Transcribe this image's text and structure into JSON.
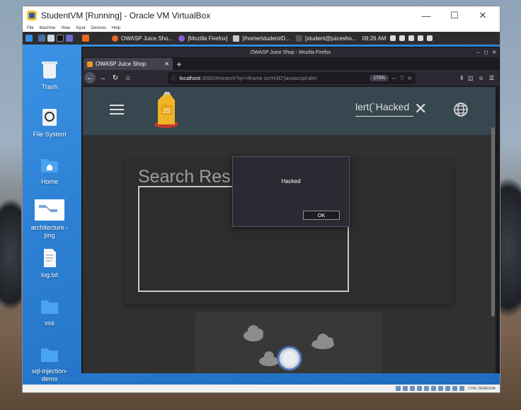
{
  "host": {
    "window_title": "StudentVM [Running] - Oracle VM VirtualBox",
    "menu": [
      "File",
      "Machine",
      "View",
      "Input",
      "Devices",
      "Help"
    ],
    "hostkey_label": "CTRL DERECHA"
  },
  "guest_panel": {
    "tasks": [
      "OWASP Juice Sho...",
      "[Mozilla Firefox]",
      "[/home/student/D...",
      "[student@juicesho..."
    ],
    "clock": "09:26 AM"
  },
  "desktop_icons": [
    {
      "label": "Trash"
    },
    {
      "label": "File System"
    },
    {
      "label": "Home"
    },
    {
      "label": "architecture.-png"
    },
    {
      "label": "log.txt"
    },
    {
      "label": "xss"
    },
    {
      "label": "sql-injection-demo"
    }
  ],
  "firefox": {
    "window_title": "OWASP Juice Shop - Mozilla Firefox",
    "tab_label": "OWASP Juice Shop",
    "url_host": "localhost",
    "url_rest": ":3000/#/search?q=<iframe src%3D\"javascript:aler",
    "zoom": "170%"
  },
  "juice_shop": {
    "search_value": "lert(`Hacked",
    "results_title": "Search Res"
  },
  "alert": {
    "message": "Hacked",
    "ok_label": "OK"
  },
  "colors": {
    "toolbar": "#37474f",
    "page_bg": "#303030",
    "guest_desktop": "#2a7bd0"
  }
}
